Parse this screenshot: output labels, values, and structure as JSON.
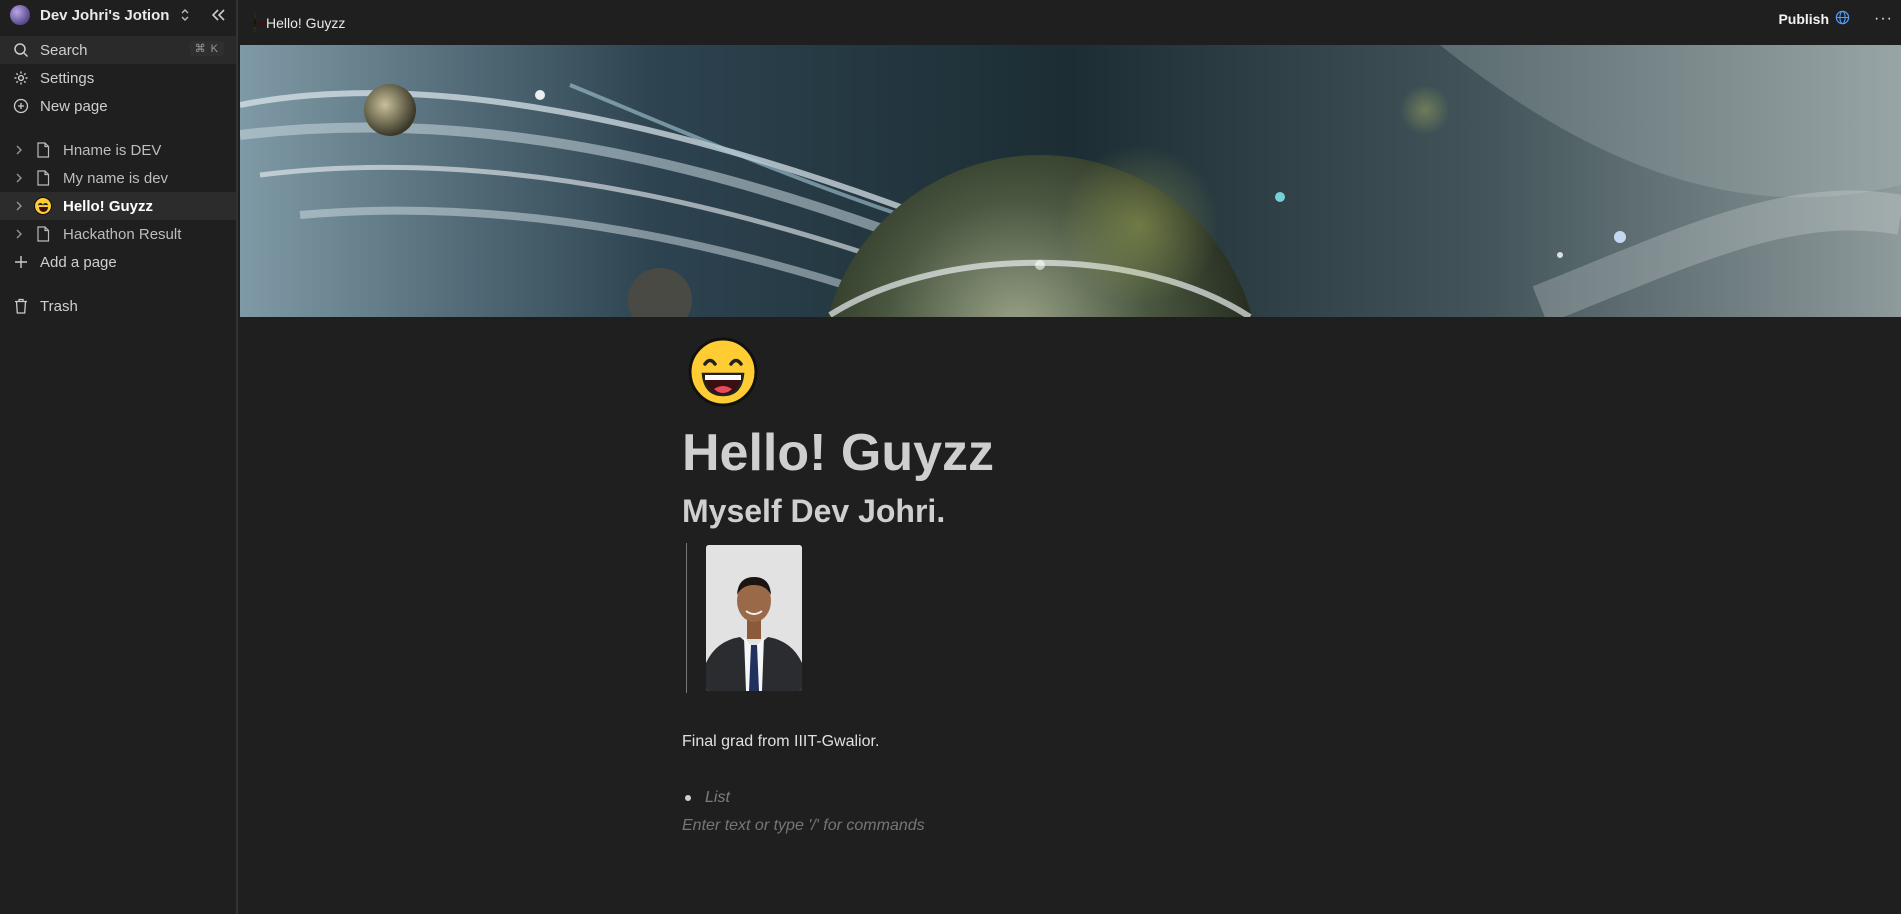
{
  "workspace": {
    "name": "Dev Johri's Jotion"
  },
  "sidebar": {
    "search": {
      "label": "Search",
      "shortcut": "⌘ K"
    },
    "settings_label": "Settings",
    "new_page_label": "New page",
    "pages": [
      {
        "label": "Hname is DEV",
        "icon": "document-icon"
      },
      {
        "label": "My name is dev",
        "icon": "document-icon"
      },
      {
        "label": "Hello! Guyzz",
        "icon": "grinning-emoji-icon",
        "active": true
      },
      {
        "label": "Hackathon Result",
        "icon": "document-icon"
      }
    ],
    "add_page_label": "Add a page",
    "trash_label": "Trash"
  },
  "topbar": {
    "title": "Hello! Guyzz",
    "publish_label": "Publish",
    "more_label": "···"
  },
  "document": {
    "title": "Hello! Guyzz",
    "heading": "Myself Dev Johri.",
    "paragraph": "Final grad from IIIT-Gwalior.",
    "list_placeholder": "List",
    "editor_placeholder": "Enter text or type '/' for commands"
  },
  "colors": {
    "background": "#1f1f1f",
    "sidebar_active": "#2c2c2c",
    "accent_globe": "#4ea1ff"
  }
}
